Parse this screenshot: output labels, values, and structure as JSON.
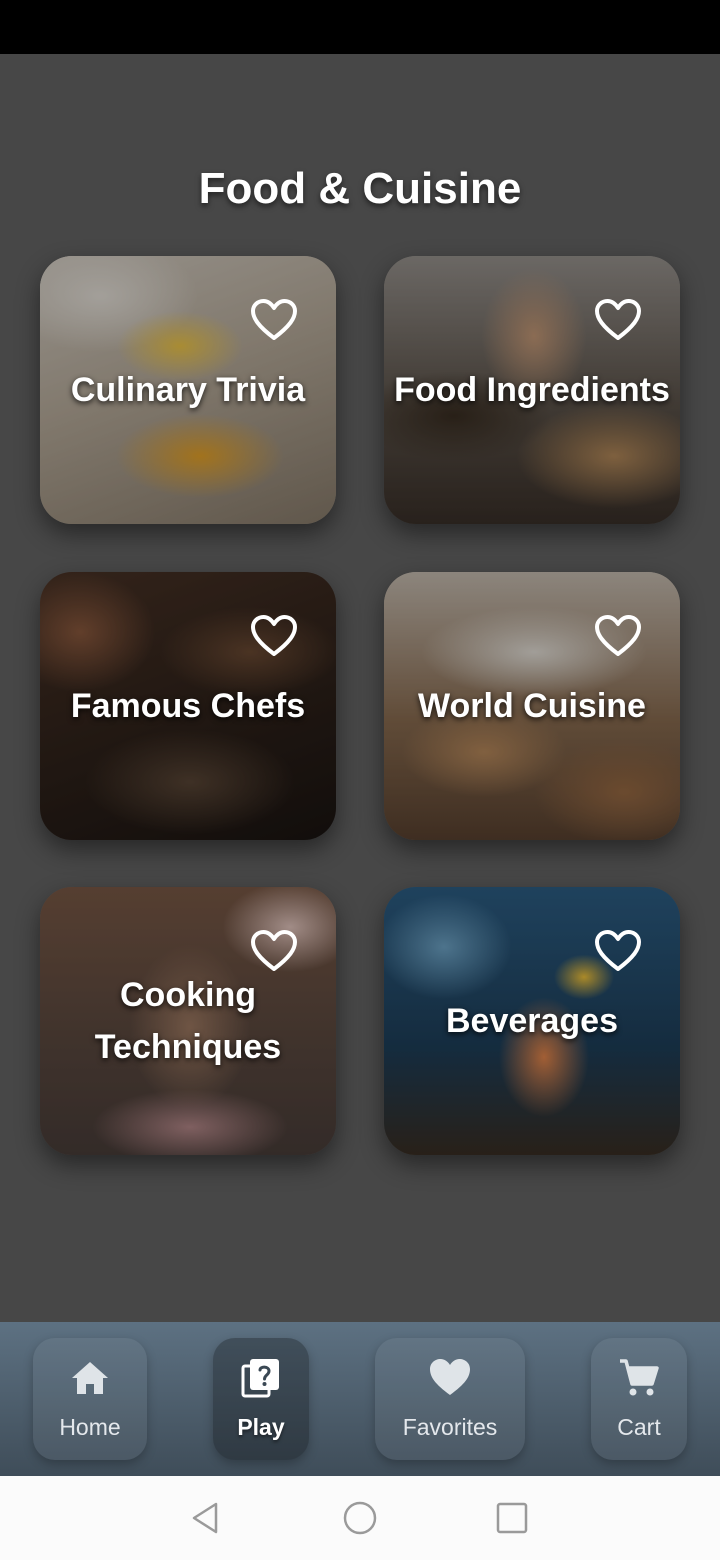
{
  "page": {
    "title": "Food & Cuisine"
  },
  "categories": [
    {
      "label": "Culinary Trivia",
      "favorite": false
    },
    {
      "label": "Food Ingredients",
      "favorite": false
    },
    {
      "label": "Famous Chefs",
      "favorite": false
    },
    {
      "label": "World Cuisine",
      "favorite": false
    },
    {
      "label": "Cooking Techniques",
      "favorite": false
    },
    {
      "label": "Beverages",
      "favorite": false
    }
  ],
  "bottom_nav": {
    "items": [
      {
        "label": "Home",
        "icon": "home-icon"
      },
      {
        "label": "Play",
        "icon": "quiz-icon",
        "active": true
      },
      {
        "label": "Favorites",
        "icon": "heart-icon"
      },
      {
        "label": "Cart",
        "icon": "cart-icon"
      }
    ]
  },
  "system_nav": {
    "icons": [
      "back-triangle-icon",
      "home-circle-icon",
      "recents-square-icon"
    ]
  },
  "colors": {
    "background": "#474747",
    "nav_top": "#5d7182",
    "nav_bottom": "#3f4d59",
    "text": "#ffffff"
  }
}
